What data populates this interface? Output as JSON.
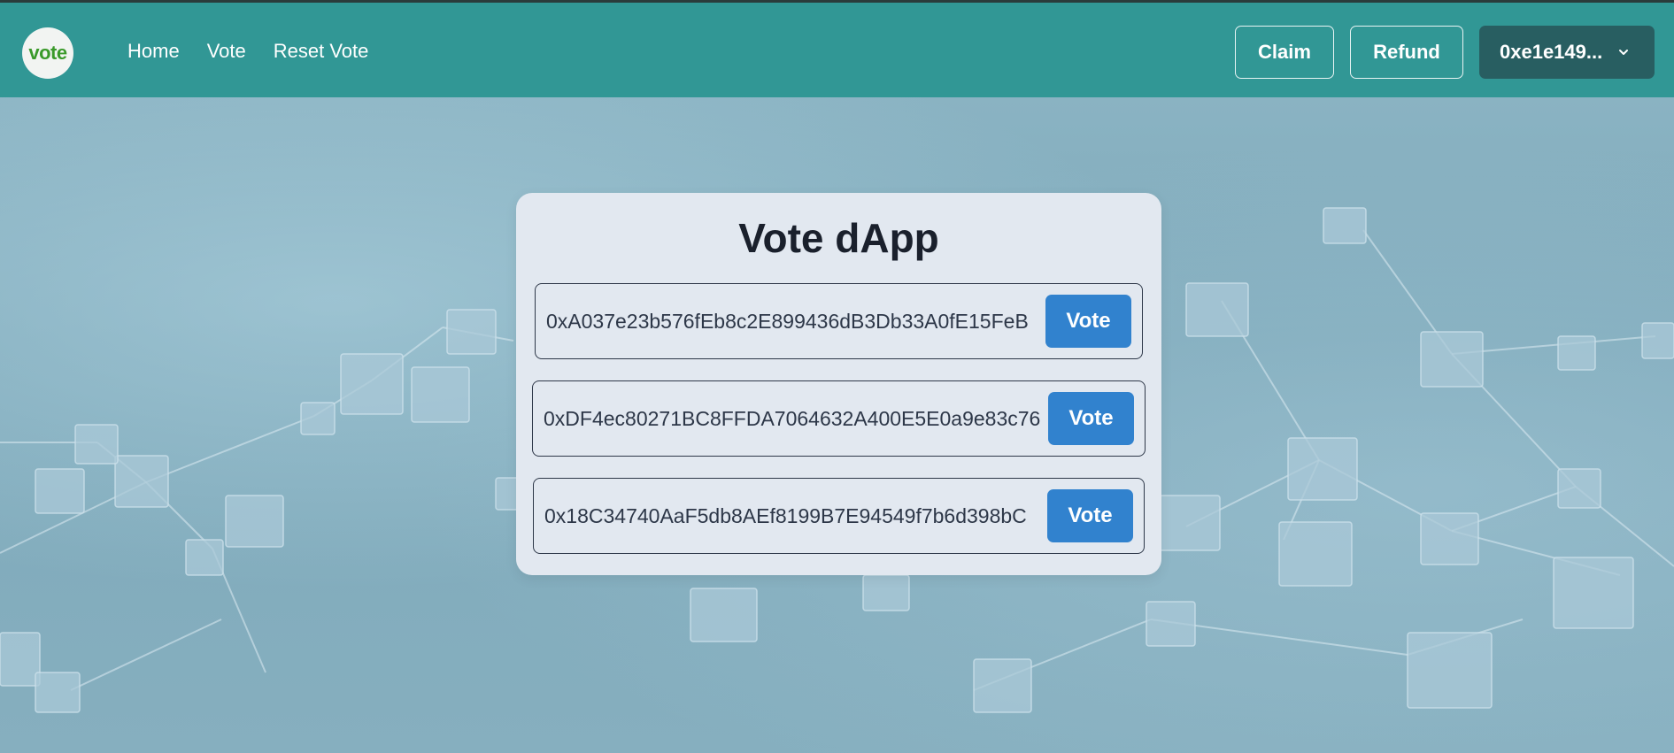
{
  "nav": {
    "logo_text": "vote",
    "links": [
      "Home",
      "Vote",
      "Reset Vote"
    ],
    "claim_label": "Claim",
    "refund_label": "Refund",
    "wallet_label": "0xe1e149...",
    "wallet_icon": "chevron-down-icon"
  },
  "card": {
    "title": "Vote dApp",
    "candidates": [
      {
        "address": "0xA037e23b576fEb8c2E899436dB3Db33A0fE15FeB",
        "button": "Vote"
      },
      {
        "address": "0xDF4ec80271BC8FFDA7064632A400E5E0a9e83c76",
        "button": "Vote"
      },
      {
        "address": "0x18C34740AaF5db8AEf8199B7E94549f7b6d398bC",
        "button": "Vote"
      }
    ]
  },
  "colors": {
    "navbar": "#319795",
    "wallet_button": "#285e61",
    "vote_button": "#3182ce",
    "card": "#e2e8f0"
  }
}
